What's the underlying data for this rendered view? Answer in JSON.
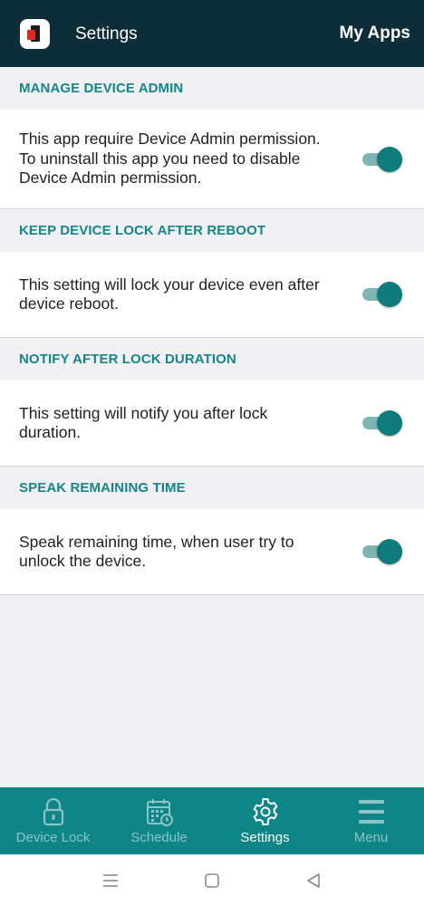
{
  "header": {
    "title": "Settings",
    "action": "My Apps"
  },
  "sections": [
    {
      "title": "MANAGE DEVICE ADMIN",
      "description_lines": [
        "This app require Device Admin permission.",
        "To uninstall this app you need to disable",
        "Device Admin permission."
      ],
      "enabled": true
    },
    {
      "title": "KEEP DEVICE LOCK AFTER REBOOT",
      "description_lines": [
        "This setting will lock your device even after",
        "device reboot."
      ],
      "enabled": true
    },
    {
      "title": "NOTIFY AFTER LOCK DURATION",
      "description_lines": [
        "This setting will notify you after lock",
        "duration."
      ],
      "enabled": true
    },
    {
      "title": "SPEAK REMAINING TIME",
      "description_lines": [
        "Speak remaining time, when user try to",
        "unlock the device."
      ],
      "enabled": true
    }
  ],
  "bottom_nav": {
    "items": [
      {
        "label": "Device Lock",
        "icon": "lock-icon",
        "active": false
      },
      {
        "label": "Schedule",
        "icon": "calendar-clock-icon",
        "active": false
      },
      {
        "label": "Settings",
        "icon": "gear-icon",
        "active": true
      },
      {
        "label": "Menu",
        "icon": "menu-icon",
        "active": false
      }
    ]
  },
  "colors": {
    "header_bg": "#0d2e38",
    "accent": "#14868b",
    "nav_bg": "#0e8586",
    "toggle_on": "#0f7b7c"
  }
}
